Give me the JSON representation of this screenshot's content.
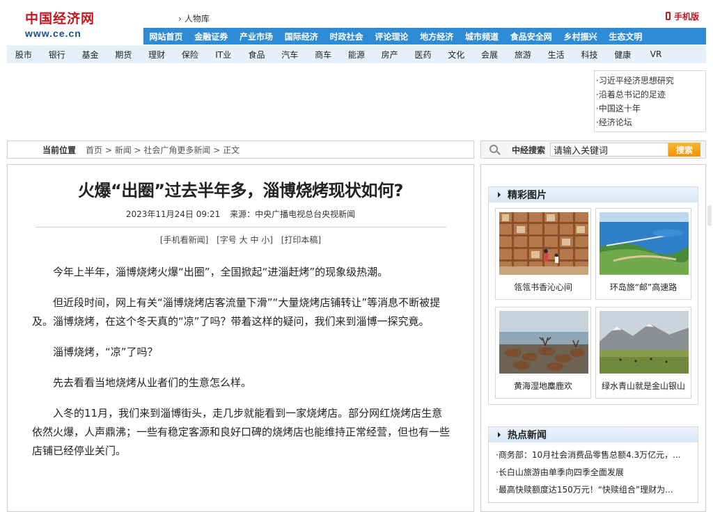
{
  "header": {
    "logo_cn": "中国经济网",
    "logo_en": "www.ce.cn",
    "top_crumb": "人物库",
    "mobile_label": "手机版"
  },
  "nav_primary": [
    "网站首页",
    "金融证券",
    "产业市场",
    "国际经济",
    "时政社会",
    "评论理论",
    "地方经济",
    "城市频道",
    "食品安全网",
    "乡村振兴",
    "生态文明"
  ],
  "nav_secondary": [
    "股市",
    "银行",
    "基金",
    "期货",
    "理财",
    "保险",
    "IT业",
    "食品",
    "汽车",
    "商车",
    "能源",
    "房产",
    "医药",
    "文化",
    "会展",
    "旅游",
    "生活",
    "科技",
    "健康",
    "VR"
  ],
  "side_links": [
    "·习近平经济思想研究",
    "·沿着总书记的足迹",
    "·中国这十年",
    "·经济论坛"
  ],
  "position": {
    "label": "当前位置",
    "path": "首页 > 新闻 > 社会广角更多新闻 > 正文"
  },
  "search": {
    "label": "中经搜索",
    "placeholder": "请输入关键词",
    "button": "搜索"
  },
  "article": {
    "title": "火爆“出圈”过去半年多，淄博烧烤现状如何?",
    "datetime": "2023年11月24日 09:21",
    "source": "来源：中央广播电视总台央视新闻",
    "tools": {
      "mobile": "[手机看新闻]",
      "font": "[字号 大 中 小]",
      "print": "[打印本稿]"
    },
    "paragraphs": [
      "今年上半年，淄博烧烤火爆“出圈”，全国掀起“进淄赶烤”的现象级热潮。",
      "但近段时间，网上有关“淄博烧烤店客流量下滑”“大量烧烤店铺转让”等消息不断被提及。淄博烧烤，在这个冬天真的“凉”了吗？带着这样的疑问，我们来到淄博一探究竟。",
      "淄博烧烤，“凉”了吗？",
      "先去看看当地烧烤从业者们的生意怎么样。",
      "入冬的11月，我们来到淄博街头，走几步就能看到一家烧烤店。部分网红烧烤店生意依然火爆，人声鼎沸；一些有稳定客源和良好口碑的烧烤店也能维持正常经营，但也有一些店铺已经停业关门。"
    ]
  },
  "gallery": {
    "title": "精彩图片",
    "items": [
      {
        "caption": "瓴瓴书香沁心间",
        "icon": "bookshelf-photo"
      },
      {
        "caption": "环岛旅“邮”高速路",
        "icon": "coastal-island-photo"
      },
      {
        "caption": "黄海湿地麋鹿欢",
        "icon": "deer-wetland-photo"
      },
      {
        "caption": "绿水青山就是金山银山",
        "icon": "grassland-mountain-photo"
      }
    ]
  },
  "hot_news": {
    "title": "热点新闻",
    "items": [
      "·商务部：10月社会消费品零售总额4.3万亿元，...",
      "·长白山旅游由单季向四季全面发展",
      "·最高快赎额度达150万元！“快赎组合”理财为..."
    ]
  },
  "colors": {
    "brand_red": "#c4161c",
    "nav_blue": "#2e8bd5",
    "subnav_bg": "#e5f0fb",
    "search_orange": "#f29100"
  }
}
